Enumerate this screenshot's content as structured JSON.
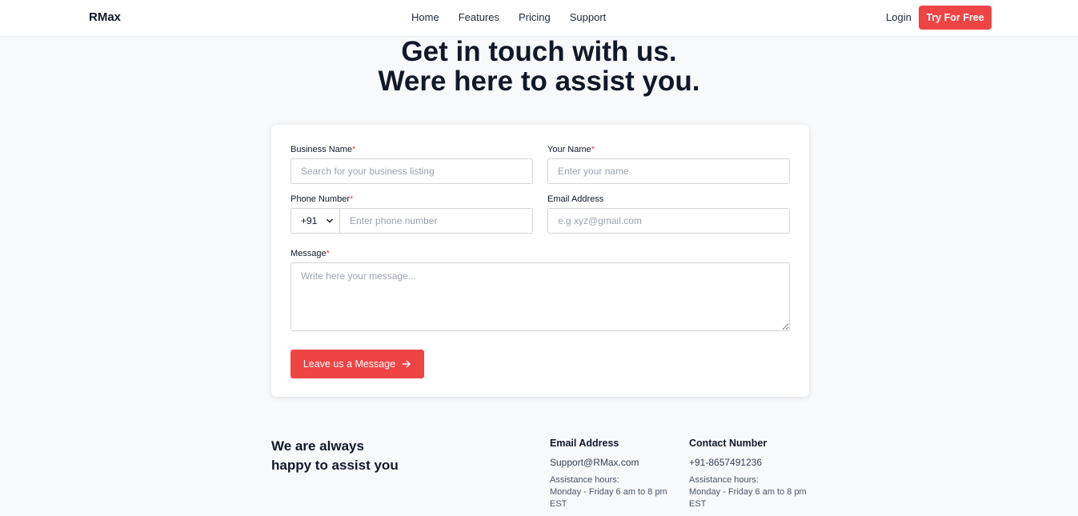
{
  "nav": {
    "brand": "RMax",
    "links": [
      "Home",
      "Features",
      "Pricing",
      "Support"
    ],
    "login": "Login",
    "cta": "Try For Free"
  },
  "hero": {
    "line1": "Get in touch with us.",
    "line2": "Were here to assist you."
  },
  "form": {
    "business_name": {
      "label": "Business Name",
      "required": "*",
      "placeholder": "Search for your business listing"
    },
    "your_name": {
      "label": "Your Name",
      "required": "*",
      "placeholder": "Enter your name"
    },
    "phone": {
      "label": "Phone Number",
      "required": "*",
      "code": "+91",
      "placeholder": "Enter phone number"
    },
    "email": {
      "label": "Email Address",
      "placeholder": "e.g xyz@gmail.com"
    },
    "message": {
      "label": "Message",
      "required": "*",
      "placeholder": "Write here your message..."
    },
    "submit": "Leave us a Message"
  },
  "contact": {
    "tagline1": "We are always",
    "tagline2": "happy to assist you",
    "email": {
      "title": "Email Address",
      "value": "Support@RMax.com",
      "hours_label": "Assistance hours:",
      "hours": "Monday - Friday 6 am to 8 pm EST"
    },
    "phone": {
      "title": "Contact Number",
      "value": "+91-8657491236",
      "hours_label": "Assistance hours:",
      "hours": "Monday - Friday 6 am to 8 pm EST"
    }
  },
  "colors": {
    "accent": "#ef4444",
    "background": "#f8f9fb",
    "text": "#111827"
  }
}
